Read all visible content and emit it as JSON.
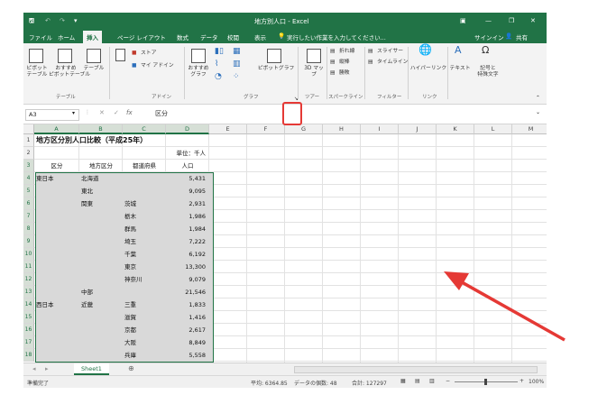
{
  "window": {
    "title": "地方別人口 - Excel",
    "signin": "サインイン",
    "share": "共有"
  },
  "tabs": [
    "ファイル",
    "ホーム",
    "挿入",
    "ページ レイアウト",
    "数式",
    "データ",
    "校閲",
    "表示"
  ],
  "tell_me": "実行したい作業を入力してください...",
  "ribbon": {
    "pivot": "ピボット\nテーブル",
    "rec_pivot": "おすすめ\nピボットテーブル",
    "table": "テーブル",
    "store": "ストア",
    "my_addins": "マイ アドイン",
    "rec_charts": "おすすめ\nグラフ",
    "pivot_chart": "ピボットグラフ",
    "map3d": "3D マッ\nプ",
    "line": "折れ線",
    "column": "縦棒",
    "winloss": "勝敗",
    "slicer": "スライサー",
    "timeline": "タイムライン",
    "hyperlink": "ハイパーリンク",
    "text": "テキスト",
    "symbol": "記号と\n特殊文字",
    "groups": [
      "テーブル",
      "アドイン",
      "グラフ",
      "ツアー",
      "スパークライン",
      "フィルター",
      "リンク"
    ]
  },
  "formula_bar": {
    "name_box": "A3",
    "value": "区分",
    "fx": "fx"
  },
  "columns": [
    "A",
    "B",
    "C",
    "D",
    "E",
    "F",
    "G",
    "H",
    "I",
    "J",
    "K",
    "L",
    "M"
  ],
  "rows": [
    "1",
    "2",
    "3",
    "4",
    "5",
    "6",
    "7",
    "8",
    "9",
    "10",
    "11",
    "12",
    "13",
    "14",
    "15",
    "16",
    "17",
    "18"
  ],
  "sheet": {
    "title": "地方区分別人口比較（平成25年）",
    "unit": "単位：千人",
    "headers": [
      "区分",
      "地方区分",
      "都道府県",
      "人口"
    ],
    "data": [
      [
        "東日本",
        "北海道",
        "",
        "5,431"
      ],
      [
        "",
        "東北",
        "",
        "9,095"
      ],
      [
        "",
        "関東",
        "茨城",
        "2,931"
      ],
      [
        "",
        "",
        "栃木",
        "1,986"
      ],
      [
        "",
        "",
        "群馬",
        "1,984"
      ],
      [
        "",
        "",
        "埼玉",
        "7,222"
      ],
      [
        "",
        "",
        "千葉",
        "6,192"
      ],
      [
        "",
        "",
        "東京",
        "13,300"
      ],
      [
        "",
        "",
        "神奈川",
        "9,079"
      ],
      [
        "",
        "中部",
        "",
        "21,546"
      ],
      [
        "西日本",
        "近畿",
        "三重",
        "1,833"
      ],
      [
        "",
        "",
        "滋賀",
        "1,416"
      ],
      [
        "",
        "",
        "京都",
        "2,617"
      ],
      [
        "",
        "",
        "大阪",
        "8,849"
      ],
      [
        "",
        "",
        "兵庫",
        "5,558"
      ]
    ]
  },
  "sheet_tab": "Sheet1",
  "status": {
    "ready": "準備完了",
    "average": "平均: 6364.85",
    "count": "データの個数: 48",
    "sum": "合計: 127297",
    "zoom": "100%"
  },
  "colors": {
    "excel_green": "#217346",
    "arrow_red": "#e53935",
    "selection": "#d9d9d9"
  }
}
